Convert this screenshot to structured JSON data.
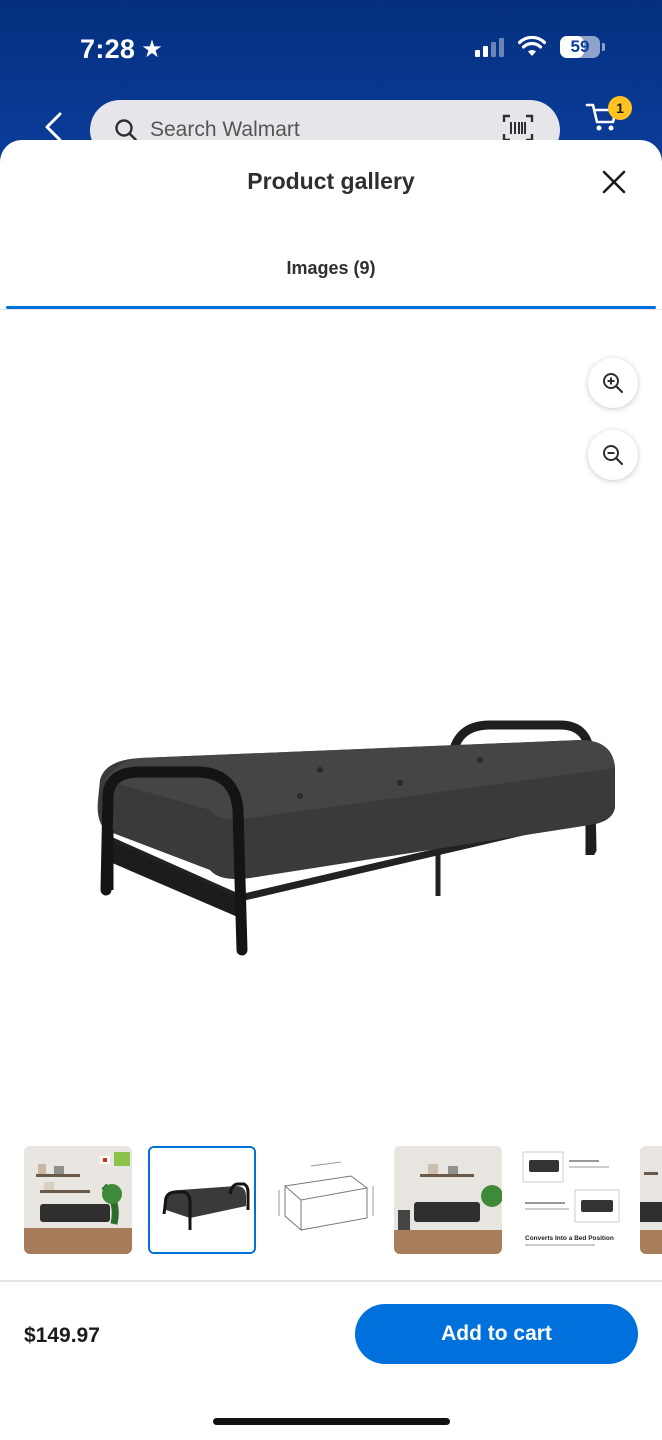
{
  "status_bar": {
    "time": "7:28",
    "battery": "59"
  },
  "header": {
    "search_placeholder": "Search Walmart",
    "cart_count": "1"
  },
  "gallery": {
    "title": "Product gallery",
    "tab_label": "Images (9)",
    "selected_thumbnail_index": 1
  },
  "thumbnail_captions": {
    "bed_position": "Converts Into a Bed Position"
  },
  "footer": {
    "price": "$149.97",
    "add_to_cart_label": "Add to cart"
  },
  "colors": {
    "walmart_blue": "#0071dc",
    "header_blue": "#0b3e9e",
    "cart_badge": "#ffc220"
  },
  "icons": [
    "star-icon",
    "back-chevron-icon",
    "search-icon",
    "barcode-icon",
    "cart-icon",
    "close-icon",
    "zoom-in-icon",
    "zoom-out-icon"
  ]
}
